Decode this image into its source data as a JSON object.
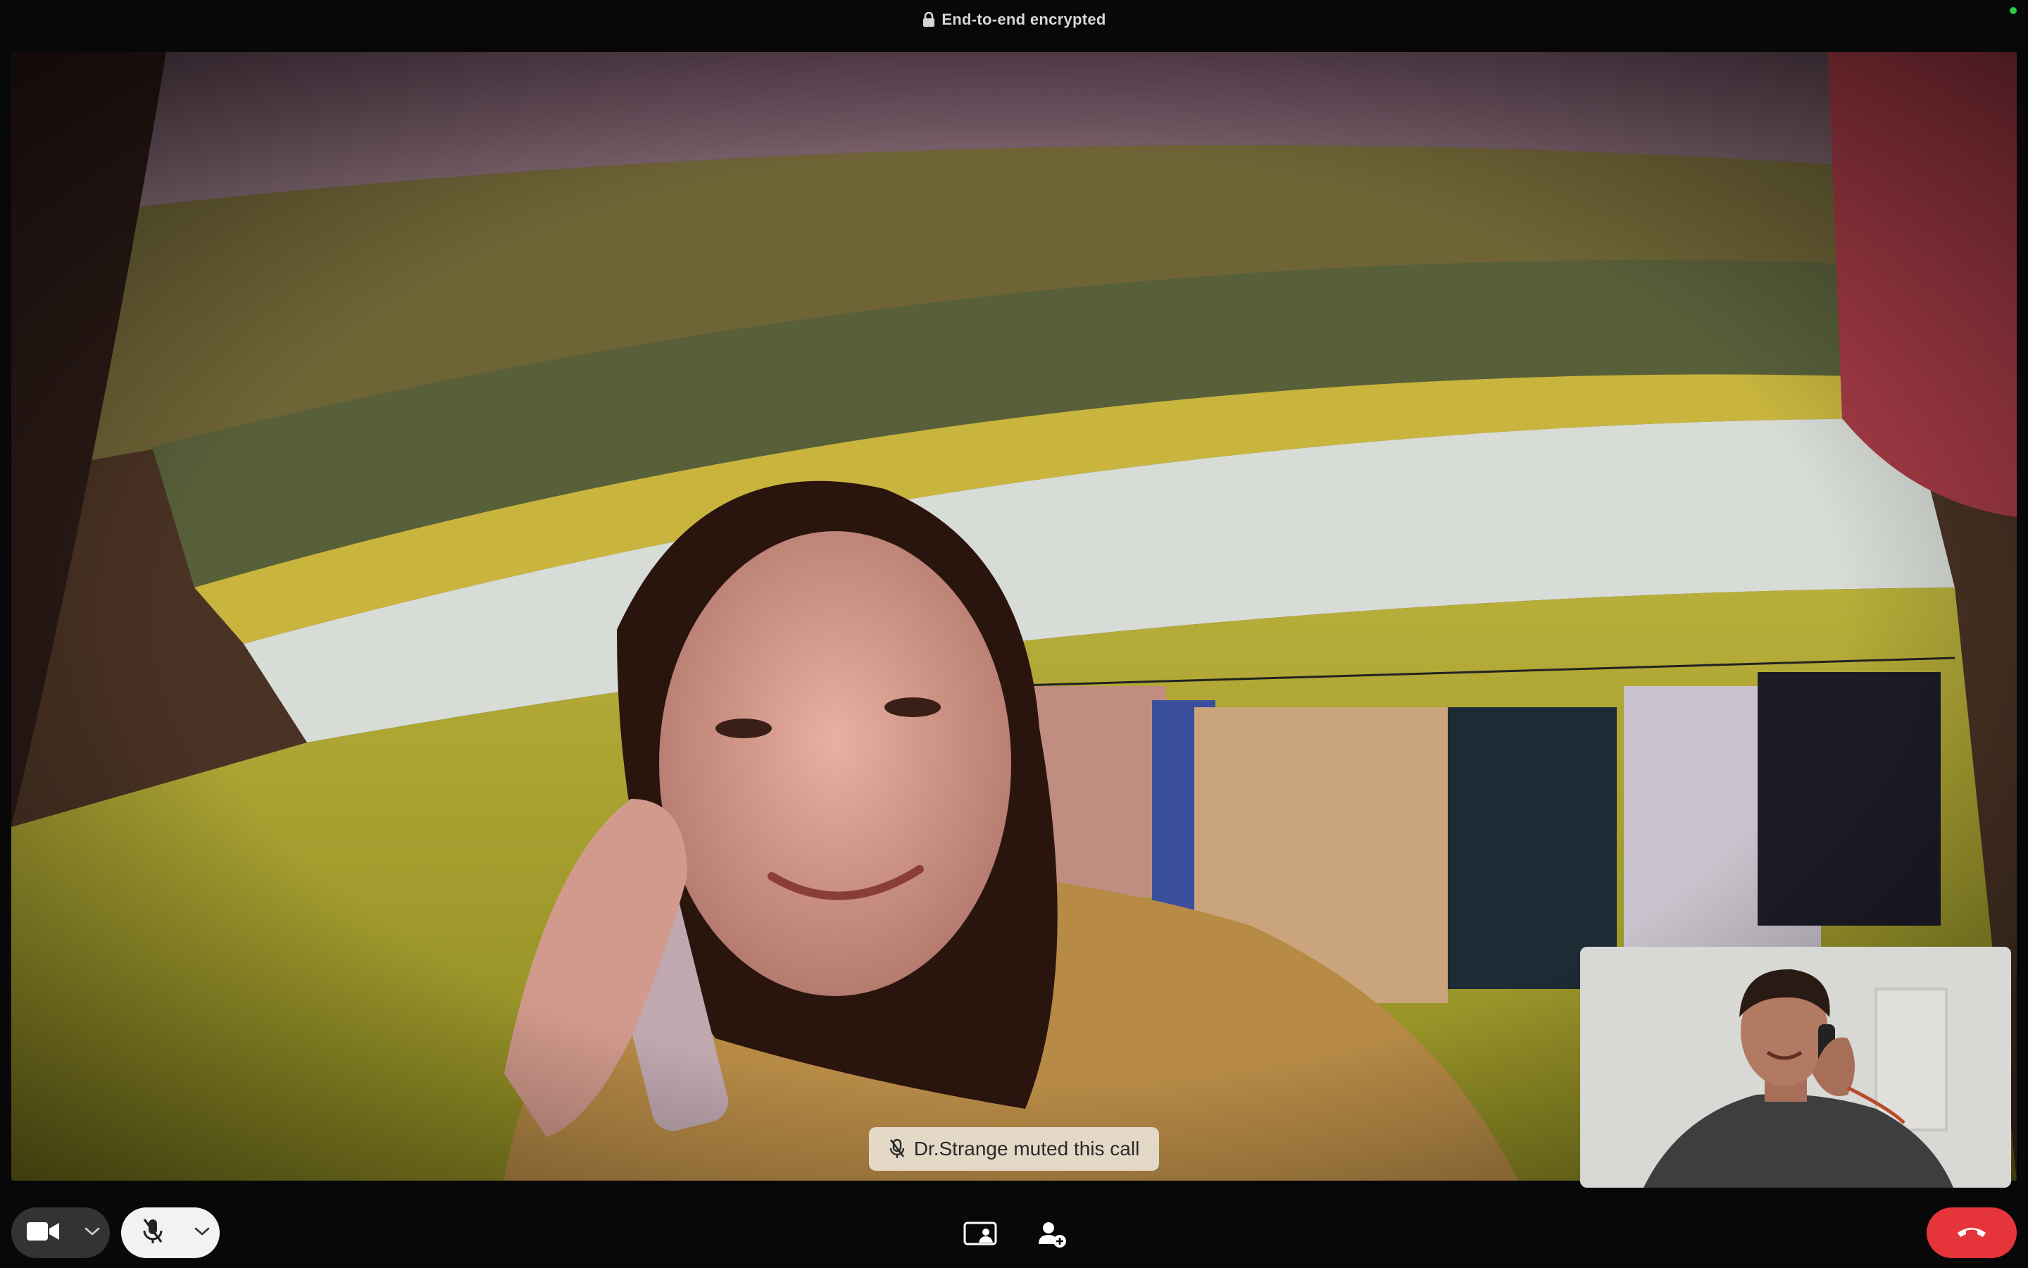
{
  "header": {
    "encryption_label": "End-to-end encrypted",
    "lock_icon": "lock-icon",
    "status_color": "#2ecc40"
  },
  "remote_video": {
    "description_icon": "remote-participant-video"
  },
  "self_preview": {
    "description_icon": "self-camera-preview"
  },
  "toast": {
    "message": "Dr.Strange muted this call",
    "icon": "mic-muted-icon"
  },
  "controls": {
    "video_icon": "video-camera-icon",
    "video_options_icon": "chevron-down-icon",
    "mic_icon": "mic-muted-icon",
    "mic_options_icon": "chevron-down-icon",
    "screen_share_icon": "screen-share-icon",
    "add_person_icon": "add-person-icon",
    "end_call_icon": "end-call-icon",
    "end_call_color": "#e5353b"
  }
}
